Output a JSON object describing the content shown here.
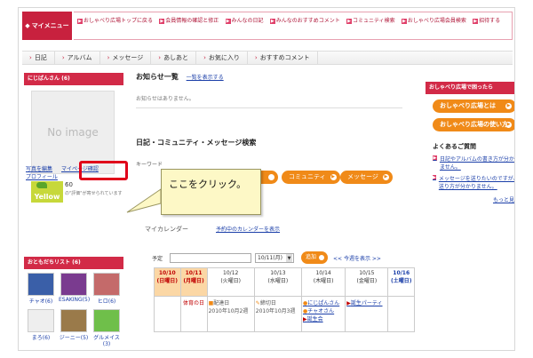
{
  "header": {
    "mymenu_label": "マイメニュー",
    "links": [
      {
        "label": "おしゃべり広場トップに戻る"
      },
      {
        "label": "会員情報の確認と修正"
      },
      {
        "label": "みんなの日記"
      },
      {
        "label": "みんなのおすすめコメント"
      },
      {
        "label": "コミュニティ検索"
      },
      {
        "label": "おしゃべり広場会員検索"
      },
      {
        "label": "招待する"
      }
    ]
  },
  "nav": {
    "items": [
      {
        "label": "日記"
      },
      {
        "label": "アルバム"
      },
      {
        "label": "メッセージ"
      },
      {
        "label": "あしあと"
      },
      {
        "label": "お気に入り"
      },
      {
        "label": "おすすめコメント"
      }
    ]
  },
  "profile": {
    "username": "にじぱんさん (6)",
    "noimage_text": "No image",
    "badge_text": "Yellow",
    "count": "60",
    "count_note": "の\"評価\"が寄せられています",
    "links": [
      "写真を編集",
      "マイページ確認",
      "プロフィール"
    ]
  },
  "friends": {
    "title": "おともだちリスト (6)",
    "items": [
      {
        "name": "チャオ(6)"
      },
      {
        "name": "ESAKING(5)"
      },
      {
        "name": "ヒロ(6)"
      },
      {
        "name": "まろ(6)"
      },
      {
        "name": "ジーニー(5)"
      },
      {
        "name": "グルメイス(3)"
      }
    ]
  },
  "main": {
    "notice_title": "お知らせ一覧",
    "notice_show_all": "一覧を表示する",
    "notice_empty": "お知らせはありません。",
    "search_title": "日記・コミュニティ・メッセージ検索",
    "keyword_label": "キーワード",
    "search_buttons": [
      "コミュニティ",
      "メッセージ"
    ],
    "callout_text": "ここをクリック。",
    "calendar_title": "マイカレンダー",
    "calendar_hint": "予約中のカレンダーを表示",
    "yotei_label": "予定",
    "date_select": "10/11(月)",
    "add_button": "追加",
    "week_nav": "<< 今週を表示 >>"
  },
  "calendar": {
    "headers": [
      {
        "date": "10/10",
        "day": "(日曜日)"
      },
      {
        "date": "10/11",
        "day": "(月曜日)"
      },
      {
        "date": "10/12",
        "day": "(火曜日)"
      },
      {
        "date": "10/13",
        "day": "(水曜日)"
      },
      {
        "date": "10/14",
        "day": "(木曜日)"
      },
      {
        "date": "10/15",
        "day": "(金曜日)"
      },
      {
        "date": "10/16",
        "day": "(土曜日)"
      }
    ],
    "cells": {
      "mon": "体育の日",
      "tue_1": "配達日",
      "tue_2": "2010年10月2週",
      "wed_1": "締切日",
      "wed_2": "2010年10月3週",
      "thu_1": "にじぱんさん",
      "thu_2": "チャオさん",
      "thu_3": "誕生会",
      "fri_1": "誕生パーティ"
    }
  },
  "sidebar_right": {
    "title": "おしゃべり広場で困ったら",
    "buttons": [
      "おしゃべり広場とは",
      "おしゃべり広場の使い方"
    ],
    "faq_title": "よくあるご質問",
    "faq_items": [
      "日記やアルバムの書き方が分かりません。",
      "メッセージを送りたいのですが、送り方が分かりません。"
    ],
    "more_label": "もっと見る"
  },
  "colors": {
    "brand_red": "#c8213e",
    "accent_orange": "#f08a18",
    "link_blue": "#1a3ea8",
    "callout_bg": "#fdf8c6",
    "highlight_red": "#e0001a"
  }
}
